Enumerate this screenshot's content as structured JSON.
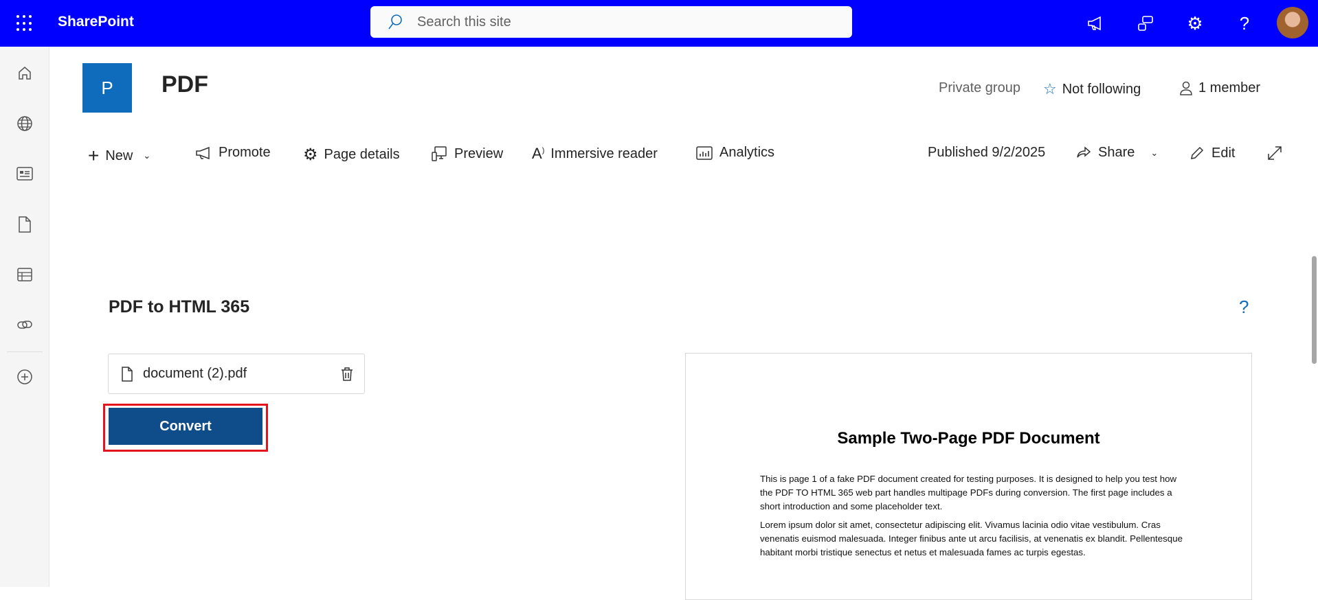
{
  "topbar": {
    "app_name": "SharePoint",
    "search_placeholder": "Search this site",
    "icons": [
      "waffle-icon",
      "megaphone-icon",
      "feedback-icon",
      "gear-icon",
      "help-icon",
      "avatar"
    ]
  },
  "rail": {
    "icons": [
      "home-icon",
      "globe-icon",
      "news-icon",
      "file-icon",
      "list-icon",
      "link-icon",
      "add-icon"
    ]
  },
  "site": {
    "logo_letter": "P",
    "title": "PDF",
    "privacy": "Private group",
    "follow": "Not following",
    "members": "1 member"
  },
  "commandbar": {
    "new": "New",
    "promote": "Promote",
    "page_details": "Page details",
    "preview": "Preview",
    "immersive_reader": "Immersive reader",
    "analytics": "Analytics",
    "published": "Published 9/2/2025",
    "share": "Share",
    "edit": "Edit"
  },
  "webpart": {
    "title": "PDF to HTML 365",
    "help": "?",
    "file_name": "document (2).pdf",
    "convert_label": "Convert"
  },
  "pdf_preview": {
    "title": "Sample Two-Page PDF Document",
    "paragraphs": [
      "This is page 1 of a fake PDF document created for testing purposes. It is designed to help you test how the PDF TO HTML 365 web part handles multipage PDFs during conversion. The first page includes a short introduction and some placeholder text.",
      "Lorem ipsum dolor sit amet, consectetur adipiscing elit. Vivamus lacinia odio vitae vestibulum. Cras venenatis euismod malesuada. Integer finibus ante ut arcu facilisis, at venenatis ex blandit. Pellentesque habitant morbi tristique senectus et netus et malesuada fames ac turpis egestas."
    ]
  },
  "colors": {
    "suite_bar": "#0000ff",
    "brand": "#0f6cbd",
    "convert": "#0f4c8a",
    "highlight": "#e3141c"
  }
}
